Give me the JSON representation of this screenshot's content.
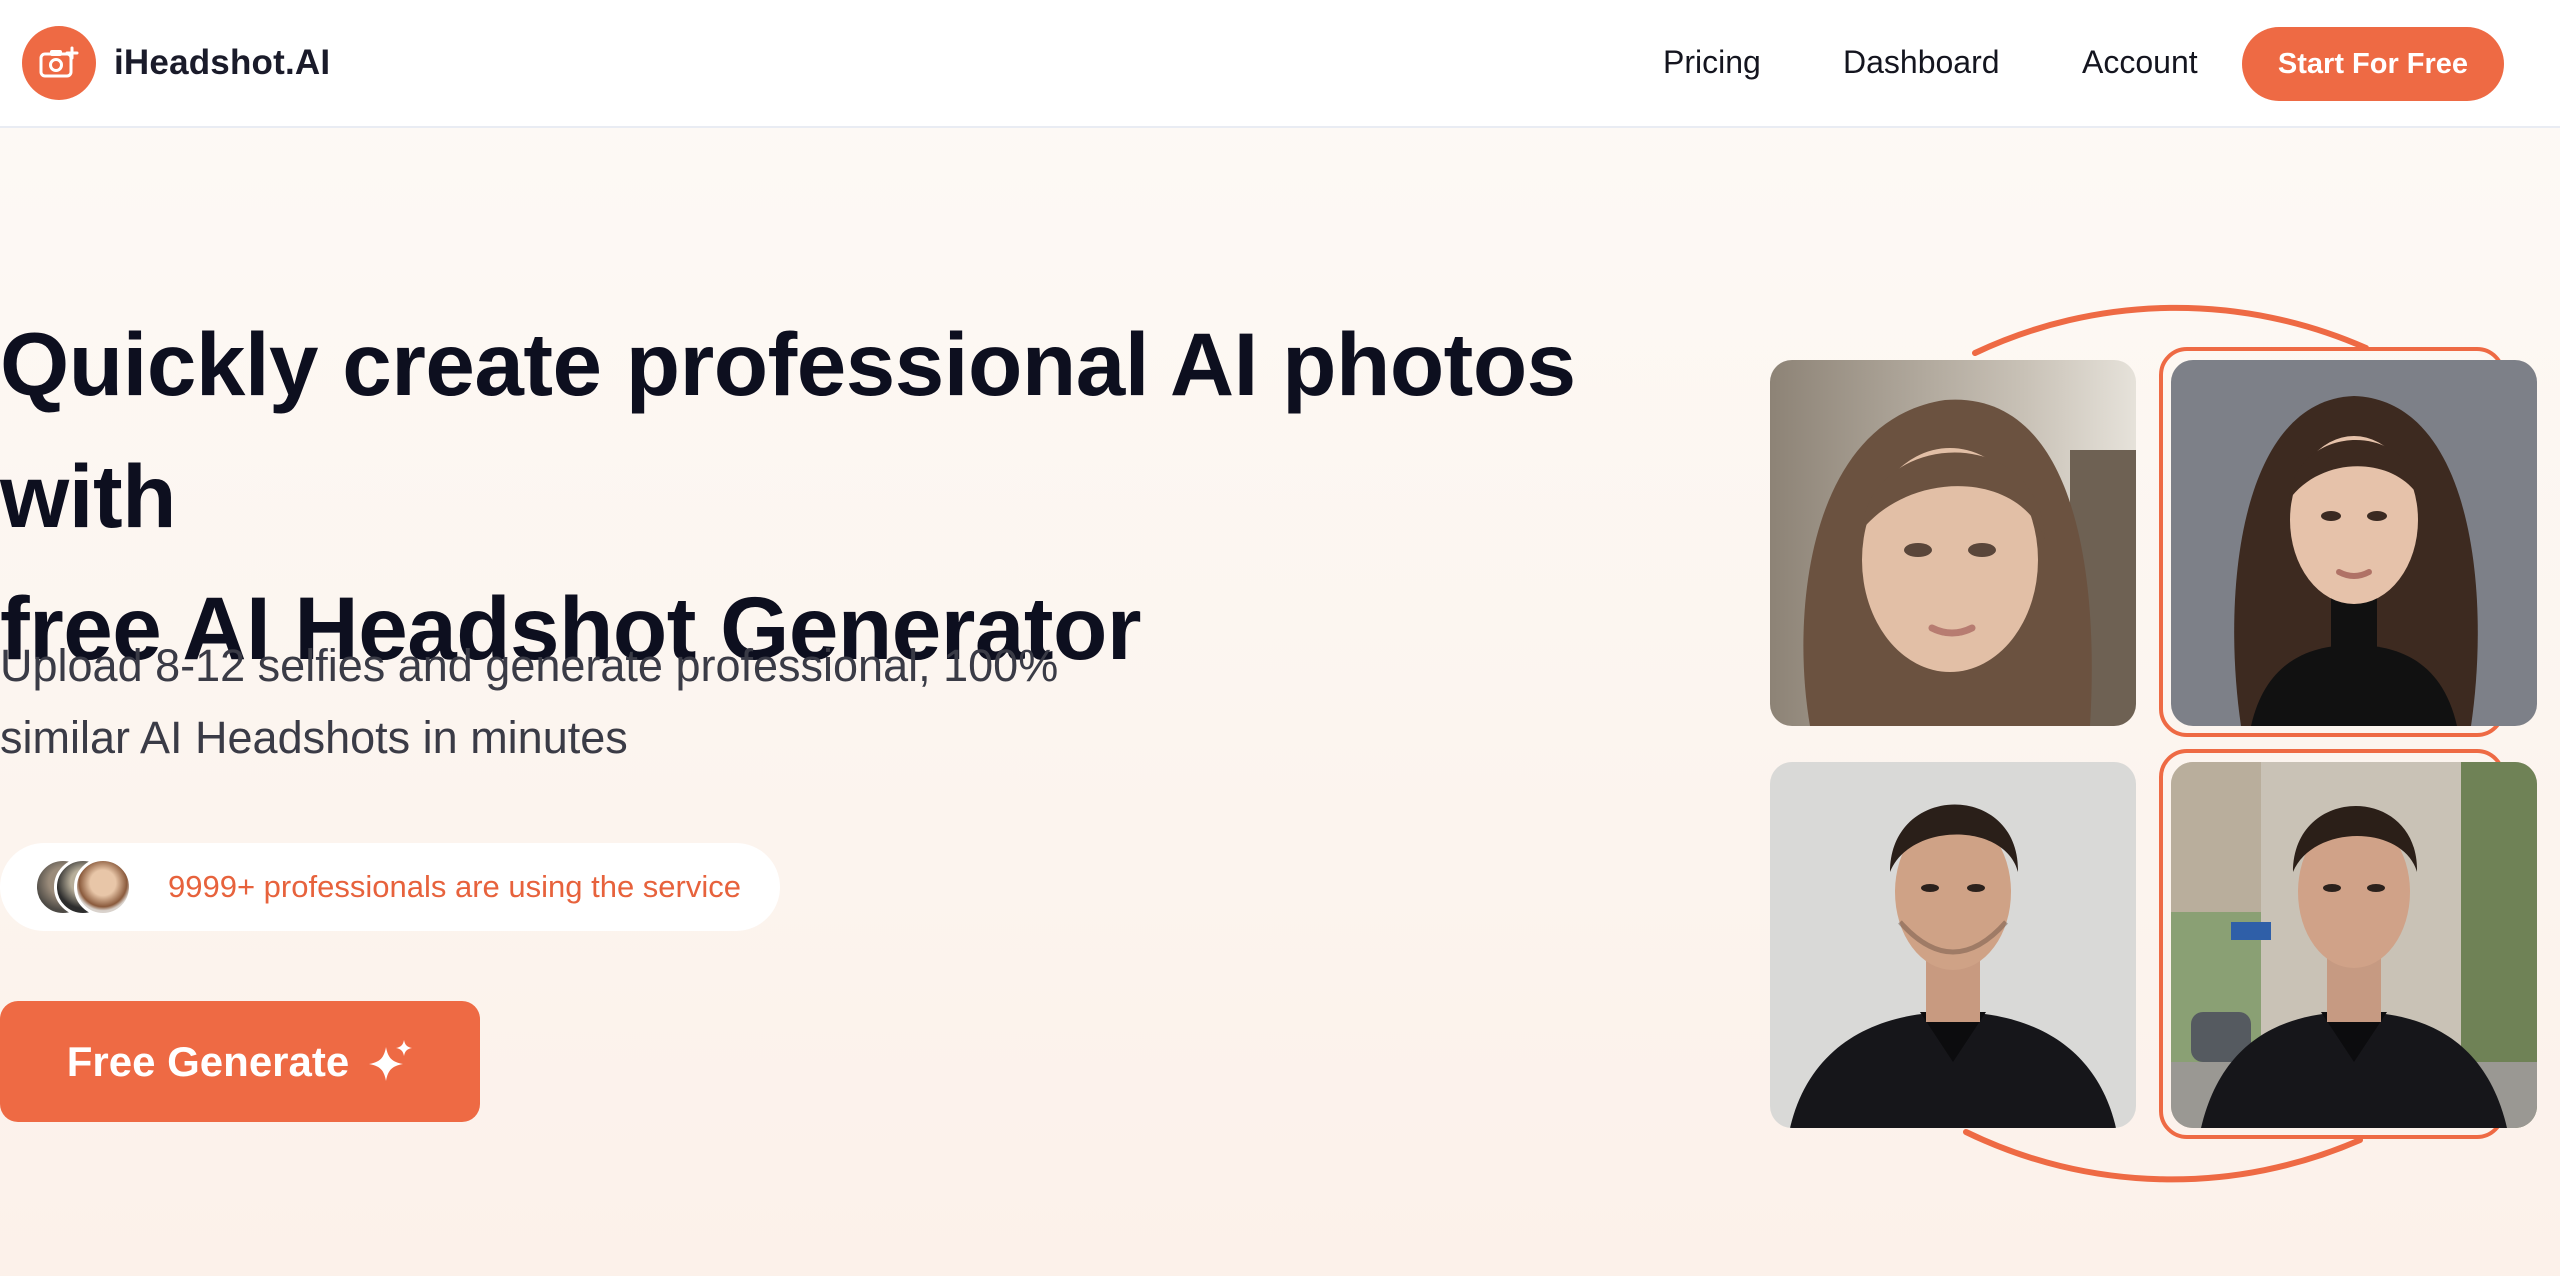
{
  "header": {
    "brand": "iHeadshot.AI",
    "nav": {
      "pricing": "Pricing",
      "dashboard": "Dashboard",
      "account": "Account"
    },
    "cta": "Start For Free"
  },
  "hero": {
    "title_line1": "Quickly create professional AI photos with",
    "title_line2": "free AI Headshot Generator",
    "subtitle_line1": "Upload 8-12 selfies and generate professional, 100%",
    "subtitle_line2": "similar AI Headshots in minutes",
    "social_proof": "9999+ professionals are using the service",
    "generate_button": "Free Generate"
  },
  "icons": {
    "logo": "camera-plus-icon",
    "generate": "sparkle-icon"
  },
  "theme": {
    "accent": "#ee6a44",
    "text_dark": "#0d0f1f",
    "text_muted": "#3a3b46"
  }
}
